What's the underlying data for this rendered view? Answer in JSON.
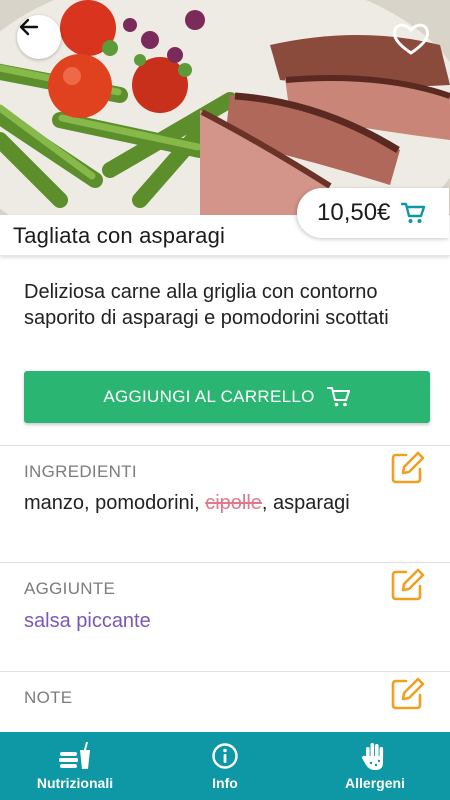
{
  "dish": {
    "name": "Tagliata con asparagi",
    "price": "10,50€",
    "description": "Deliziosa carne alla griglia con contorno saporito di asparagi e pomodorini scottati",
    "image_icon": "dish-photo"
  },
  "actions": {
    "add_to_cart_label": "AGGIUNGI AL CARRELLO"
  },
  "sections": {
    "ingredients": {
      "label": "INGREDIENTI",
      "items_before": "manzo, pomodorini, ",
      "removed_item": "cipolle",
      "items_after": ", asparagi"
    },
    "additions": {
      "label": "AGGIUNTE",
      "value": "salsa piccante"
    },
    "notes": {
      "label": "NOTE"
    }
  },
  "nav": {
    "items": [
      {
        "label": "Nutrizionali",
        "icon": "nutrition-icon"
      },
      {
        "label": "Info",
        "icon": "info-icon"
      },
      {
        "label": "Allergeni",
        "icon": "allergen-hand-icon"
      }
    ]
  },
  "colors": {
    "accent_green": "#2bb573",
    "nav_teal": "#0e97a4",
    "edit_orange": "#f0a020",
    "additions_purple": "#7b57b8",
    "removed_pink": "#e07a8a"
  }
}
